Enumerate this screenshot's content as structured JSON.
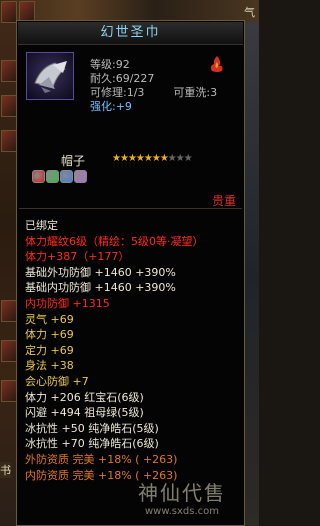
{
  "game_ui": {
    "top_right_tag": "气",
    "side_tag": "书"
  },
  "tooltip": {
    "item_name": "幻世圣巾",
    "stats": {
      "level_label": "等级:",
      "level_value": "92",
      "durability_label": "耐久:",
      "durability_value": "69/227",
      "repairable_label": "可修理:",
      "repairable_value": "1/3",
      "rewash_label": "可重洗:",
      "rewash_value": "3",
      "refine_label": "强化:",
      "refine_value": "+9"
    },
    "item_type": "帽子",
    "stars": {
      "filled": 7,
      "total": 10
    },
    "gems": [
      {
        "name": "red-gem-icon",
        "color": "#d82020"
      },
      {
        "name": "green-gem-icon",
        "color": "#30c040"
      },
      {
        "name": "blue-gem-icon",
        "color": "#4080e0"
      },
      {
        "name": "purple-gem-icon",
        "color": "#b070d0"
      }
    ],
    "rarity": "贵重",
    "properties": [
      {
        "text": "已绑定",
        "color": "white"
      },
      {
        "text": "体力耀纹6级（精绘：5级0等·凝望）",
        "color": "red"
      },
      {
        "text": "体力+387（+177）",
        "color": "red"
      },
      {
        "text": "基础外功防御 +1460 +390%",
        "color": "white"
      },
      {
        "text": "基础内功防御 +1460 +390%",
        "color": "white"
      },
      {
        "text": "内功防御 +1315",
        "color": "red"
      },
      {
        "text": "灵气 +69",
        "color": "yellow"
      },
      {
        "text": "体力 +69",
        "color": "yellow"
      },
      {
        "text": "定力 +69",
        "color": "yellow"
      },
      {
        "text": "身法 +38",
        "color": "yellow"
      },
      {
        "text": "会心防御 +7",
        "color": "yellow"
      },
      {
        "text": "体力 +206 红宝石(6级)",
        "color": "white"
      },
      {
        "text": "闪避 +494 祖母绿(5级)",
        "color": "white"
      },
      {
        "text": "冰抗性 +50 纯净皓石(5级)",
        "color": "white"
      },
      {
        "text": "冰抗性 +70 纯净皓石(6级)",
        "color": "white"
      },
      {
        "text": "外防资质   完美 +18% ( +263)",
        "color": "orange"
      },
      {
        "text": "内防资质   完美 +18% ( +263)",
        "color": "orange"
      }
    ]
  },
  "watermark": {
    "main": "神仙代售",
    "url": "www.sxds.com"
  },
  "colors": {
    "title_text": "#8fd4ee",
    "red": "#ff2a1a",
    "green": "#40e040",
    "cyan": "#7ad6ef",
    "yellow": "#e8c84a",
    "orange": "#e07820",
    "rarity": "#d83030"
  }
}
